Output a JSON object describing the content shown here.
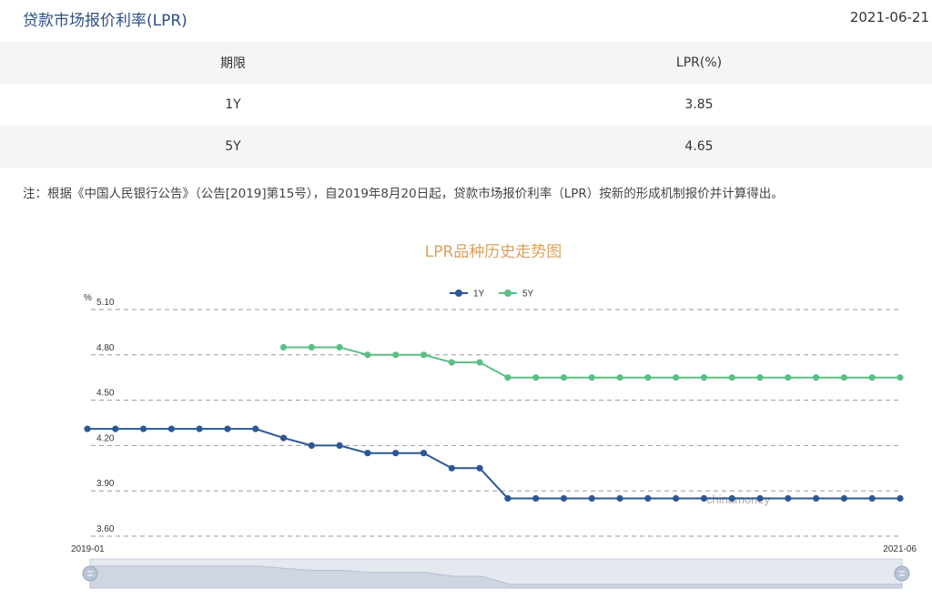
{
  "header": {
    "title": "贷款市场报价利率(LPR)",
    "date": "2021-06-21"
  },
  "table": {
    "columns": [
      "期限",
      "LPR(%)"
    ],
    "rows": [
      [
        "1Y",
        "3.85"
      ],
      [
        "5Y",
        "4.65"
      ]
    ]
  },
  "note": "注：根据《中国人民银行公告》（公告[2019]第15号），自2019年8月20日起，贷款市场报价利率（LPR）按新的形成机制报价并计算得出。",
  "chart_data": {
    "type": "line",
    "title": "LPR品种历史走势图",
    "ylabel": "%",
    "ylim": [
      3.6,
      5.1
    ],
    "yticks": [
      "5.10",
      "4.80",
      "4.50",
      "4.20",
      "3.90",
      "3.60"
    ],
    "xlabels": [
      "2019-01",
      "2021-06"
    ],
    "legend_position": "top-center",
    "grid": true,
    "watermark": "chinamoney",
    "series": [
      {
        "name": "1Y",
        "color": "#2b5797",
        "values": [
          4.31,
          4.31,
          4.31,
          4.31,
          4.31,
          4.31,
          4.31,
          4.25,
          4.2,
          4.2,
          4.15,
          4.15,
          4.15,
          4.05,
          4.05,
          3.85,
          3.85,
          3.85,
          3.85,
          3.85,
          3.85,
          3.85,
          3.85,
          3.85,
          3.85,
          3.85,
          3.85,
          3.85,
          3.85,
          3.85
        ]
      },
      {
        "name": "5Y",
        "color": "#5bbf84",
        "values": [
          null,
          null,
          null,
          null,
          null,
          null,
          null,
          4.85,
          4.85,
          4.85,
          4.8,
          4.8,
          4.8,
          4.75,
          4.75,
          4.65,
          4.65,
          4.65,
          4.65,
          4.65,
          4.65,
          4.65,
          4.65,
          4.65,
          4.65,
          4.65,
          4.65,
          4.65,
          4.65,
          4.65
        ]
      }
    ]
  },
  "slider": {
    "start_label": "≡",
    "end_label": "≡"
  }
}
